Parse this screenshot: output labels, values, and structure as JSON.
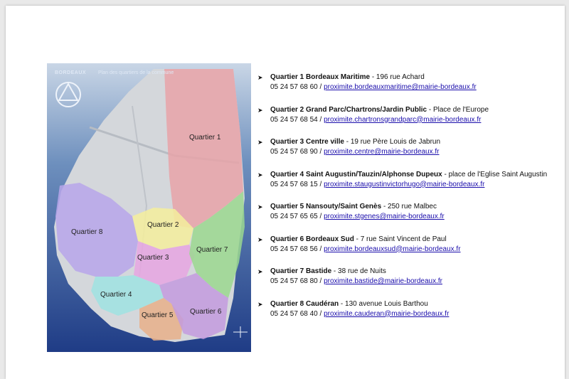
{
  "map": {
    "brand": "BORDEAUX",
    "title": "Plan des quartiers de la commune",
    "labels": [
      "Quartier 1",
      "Quartier 2",
      "Quartier 3",
      "Quartier 4",
      "Quartier 5",
      "Quartier 6",
      "Quartier 7",
      "Quartier 8"
    ],
    "colors": {
      "q1": "#e8a3a8",
      "q2": "#f4ef9c",
      "q3": "#e6a6e2",
      "q4": "#9fe3e2",
      "q5": "#e8b08a",
      "q6": "#c39bde",
      "q7": "#9bd88f",
      "q8": "#b7a6ea"
    }
  },
  "quartiers": [
    {
      "name": "Quartier 1 Bordeaux Maritime",
      "address": " - 196 rue Achard",
      "phone": "05 24 57 68 60 / ",
      "email": "proximite.bordeauxmaritime@mairie-bordeaux.fr"
    },
    {
      "name": "Quartier 2 Grand Parc/Chartrons/Jardin Public",
      "address": " - Place de l'Europe",
      "phone": "05 24 57 68 54 / ",
      "email": "proximite.chartronsgrandparc@mairie-bordeaux.fr"
    },
    {
      "name": "Quartier 3 Centre ville",
      "address": " - 19 rue Père Louis de Jabrun",
      "phone": "05 24 57 68 90 / ",
      "email": "proximite.centre@mairie-bordeaux.fr"
    },
    {
      "name": "Quartier 4 Saint Augustin/Tauzin/Alphonse Dupeux",
      "address": " - place de l'Eglise Saint Augustin",
      "phone": "05 24 57 68 15 / ",
      "email": "proximite.staugustinvictorhugo@mairie-bordeaux.fr"
    },
    {
      "name": "Quartier 5 Nansouty/Saint Genès",
      "address": " - 250 rue Malbec",
      "phone": "05 24 57 65 65 / ",
      "email": "proximite.stgenes@mairie-bordeaux.fr"
    },
    {
      "name": "Quartier 6 Bordeaux Sud",
      "address": " - 7 rue Saint Vincent de Paul",
      "phone": "05 24 57 68 56 / ",
      "email": "proximite.bordeauxsud@mairie-bordeaux.fr"
    },
    {
      "name": "Quartier 7 Bastide",
      "address": " - 38 rue de Nuits",
      "phone": " 05 24 57 68 80 / ",
      "email": "proximite.bastide@mairie-bordeaux.fr"
    },
    {
      "name": "Quartier 8 Caudéran",
      "address": " - 130 avenue Louis Barthou",
      "phone": "05 24 57 68 40 / ",
      "email": "proximite.cauderan@mairie-bordeaux.fr"
    }
  ]
}
